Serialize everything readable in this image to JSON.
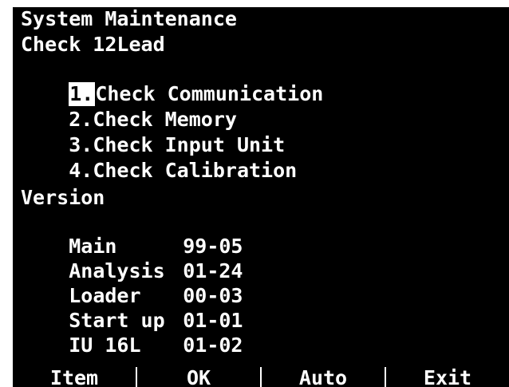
{
  "header": {
    "title": "System Maintenance",
    "subtitle": "Check 12Lead"
  },
  "menu": [
    {
      "number": "1.",
      "label": "Check Communication",
      "selected": true
    },
    {
      "number": "2.",
      "label": "Check Memory",
      "selected": false
    },
    {
      "number": "3.",
      "label": "Check Input Unit",
      "selected": false
    },
    {
      "number": "4.",
      "label": "Check Calibration",
      "selected": false
    }
  ],
  "version": {
    "heading": "Version",
    "rows": [
      {
        "name": "Main",
        "value": "99-05"
      },
      {
        "name": "Analysis",
        "value": "01-24"
      },
      {
        "name": "Loader",
        "value": "00-03"
      },
      {
        "name": "Start up",
        "value": "01-01"
      },
      {
        "name": "IU 16L",
        "value": "01-02"
      }
    ]
  },
  "softkeys": [
    {
      "label": "Item"
    },
    {
      "label": "OK"
    },
    {
      "label": "Auto"
    },
    {
      "label": "Exit"
    }
  ],
  "colors": {
    "background": "#000000",
    "foreground": "#ffffff"
  }
}
